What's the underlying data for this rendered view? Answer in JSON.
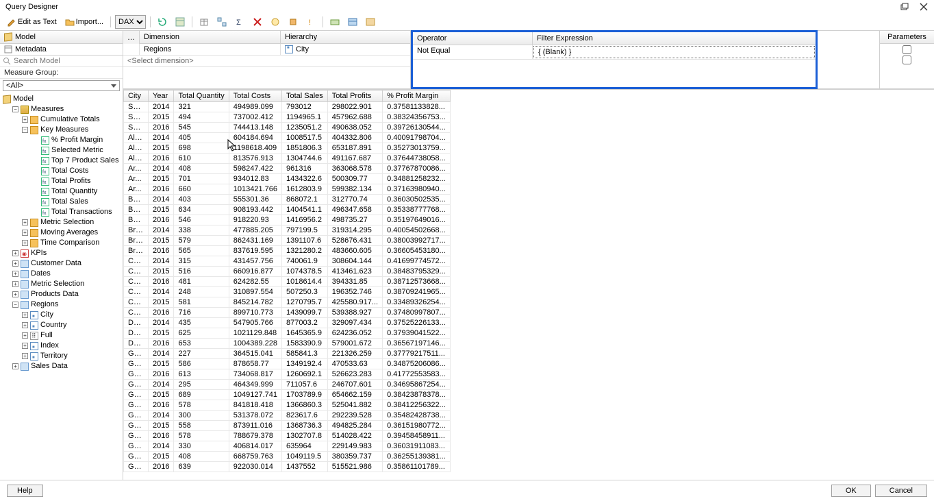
{
  "window": {
    "title": "Query Designer"
  },
  "toolbar": {
    "edit_as_text": "Edit as Text",
    "import": "Import...",
    "mode": "DAX"
  },
  "left": {
    "model_header": "Model",
    "metadata": "Metadata",
    "search_placeholder": "Search Model",
    "measure_group_label": "Measure Group:",
    "measure_group_value": "<All>",
    "tree": {
      "model": "Model",
      "measures": "Measures",
      "cumulative_totals": "Cumulative Totals",
      "key_measures": "Key Measures",
      "pct_profit_margin": "% Profit Margin",
      "selected_metric": "Selected Metric",
      "top7": "Top 7 Product Sales",
      "total_costs": "Total Costs",
      "total_profits": "Total Profits",
      "total_quantity": "Total Quantity",
      "total_sales": "Total Sales",
      "total_transactions": "Total Transactions",
      "metric_selection": "Metric Selection",
      "moving_averages": "Moving Averages",
      "time_comparison": "Time Comparison",
      "kpis": "KPIs",
      "customer_data": "Customer Data",
      "dates": "Dates",
      "metric_selection2": "Metric Selection",
      "products_data": "Products Data",
      "regions": "Regions",
      "city": "City",
      "country": "Country",
      "full": "Full",
      "index": "Index",
      "territory": "Territory",
      "sales_data": "Sales Data"
    }
  },
  "dim_area": {
    "dimension": "Dimension",
    "hierarchy": "Hierarchy",
    "row_dimension": "Regions",
    "row_hierarchy": "City",
    "select_dimension": "<Select dimension>"
  },
  "filter_area": {
    "operator": "Operator",
    "filter_expression": "Filter Expression",
    "row_operator": "Not Equal",
    "row_expression": "{ (Blank) }",
    "parameters": "Parameters"
  },
  "grid": {
    "headers": [
      "City",
      "Year",
      "Total Quantity",
      "Total Costs",
      "Total Sales",
      "Total Profits",
      "% Profit Margin"
    ],
    "rows": [
      [
        "Syd...",
        "2014",
        "321",
        "494989.099",
        "793012",
        "298022.901",
        "0.37581133828..."
      ],
      [
        "Syd...",
        "2015",
        "494",
        "737002.412",
        "1194965.1",
        "457962.688",
        "0.38324356753..."
      ],
      [
        "Syd...",
        "2016",
        "545",
        "744413.148",
        "1235051.2",
        "490638.052",
        "0.39726130544..."
      ],
      [
        "Alb...",
        "2014",
        "405",
        "604184.694",
        "1008517.5",
        "404332.806",
        "0.40091798704..."
      ],
      [
        "Alb...",
        "2015",
        "698",
        "1198618.409",
        "1851806.3",
        "653187.891",
        "0.35273013759..."
      ],
      [
        "Alb...",
        "2016",
        "610",
        "813576.913",
        "1304744.6",
        "491167.687",
        "0.37644738058..."
      ],
      [
        "Ar...",
        "2014",
        "408",
        "598247.422",
        "961316",
        "363068.578",
        "0.37767870086..."
      ],
      [
        "Ar...",
        "2015",
        "701",
        "934012.83",
        "1434322.6",
        "500309.77",
        "0.34881258232..."
      ],
      [
        "Ar...",
        "2016",
        "660",
        "1013421.766",
        "1612803.9",
        "599382.134",
        "0.37163980940..."
      ],
      [
        "Bat...",
        "2014",
        "403",
        "555301.36",
        "868072.1",
        "312770.74",
        "0.36030502535..."
      ],
      [
        "Bat...",
        "2015",
        "634",
        "908193.442",
        "1404541.1",
        "496347.658",
        "0.35338777768..."
      ],
      [
        "Bat...",
        "2016",
        "546",
        "918220.93",
        "1416956.2",
        "498735.27",
        "0.35197649016..."
      ],
      [
        "Bro...",
        "2014",
        "338",
        "477885.205",
        "797199.5",
        "319314.295",
        "0.40054502668..."
      ],
      [
        "Bro...",
        "2015",
        "579",
        "862431.169",
        "1391107.6",
        "528676.431",
        "0.38003992717..."
      ],
      [
        "Bro...",
        "2016",
        "565",
        "837619.595",
        "1321280.2",
        "483660.605",
        "0.36605453180..."
      ],
      [
        "Ces...",
        "2014",
        "315",
        "431457.756",
        "740061.9",
        "308604.144",
        "0.41699774572..."
      ],
      [
        "Ces...",
        "2015",
        "516",
        "660916.877",
        "1074378.5",
        "413461.623",
        "0.38483795329..."
      ],
      [
        "Ces...",
        "2016",
        "481",
        "624282.55",
        "1018614.4",
        "394331.85",
        "0.38712573668..."
      ],
      [
        "Cof...",
        "2014",
        "248",
        "310897.554",
        "507250.3",
        "196352.746",
        "0.38709241965..."
      ],
      [
        "Cof...",
        "2015",
        "581",
        "845214.782",
        "1270795.7",
        "425580.917...",
        "0.33489326254..."
      ],
      [
        "Cof...",
        "2016",
        "716",
        "899710.773",
        "1439099.7",
        "539388.927",
        "0.37480997807..."
      ],
      [
        "Du...",
        "2014",
        "435",
        "547905.766",
        "877003.2",
        "329097.434",
        "0.37525226133..."
      ],
      [
        "Du...",
        "2015",
        "625",
        "1021129.848",
        "1645365.9",
        "624236.052",
        "0.37939041522..."
      ],
      [
        "Du...",
        "2016",
        "653",
        "1004389.228",
        "1583390.9",
        "579001.672",
        "0.36567197146..."
      ],
      [
        "Go...",
        "2014",
        "227",
        "364515.041",
        "585841.3",
        "221326.259",
        "0.37779217511..."
      ],
      [
        "Go...",
        "2015",
        "586",
        "878658.77",
        "1349192.4",
        "470533.63",
        "0.34875206086..."
      ],
      [
        "Go...",
        "2016",
        "613",
        "734068.817",
        "1260692.1",
        "526623.283",
        "0.41772553583..."
      ],
      [
        "Go...",
        "2014",
        "295",
        "464349.999",
        "711057.6",
        "246707.601",
        "0.34695867254..."
      ],
      [
        "Go...",
        "2015",
        "689",
        "1049127.741",
        "1703789.9",
        "654662.159",
        "0.38423878378..."
      ],
      [
        "Go...",
        "2016",
        "578",
        "841818.418",
        "1366860.3",
        "525041.882",
        "0.38412256322..."
      ],
      [
        "Gra...",
        "2014",
        "300",
        "531378.072",
        "823617.6",
        "292239.528",
        "0.35482428738..."
      ],
      [
        "Gra...",
        "2015",
        "558",
        "873911.016",
        "1368736.3",
        "494825.284",
        "0.36151980772..."
      ],
      [
        "Gra...",
        "2016",
        "578",
        "788679.378",
        "1302707.8",
        "514028.422",
        "0.39458458911..."
      ],
      [
        "Grif...",
        "2014",
        "330",
        "406814.017",
        "635964",
        "229149.983",
        "0.36031911083..."
      ],
      [
        "Grif...",
        "2015",
        "408",
        "668759.763",
        "1049119.5",
        "380359.737",
        "0.36255139381..."
      ],
      [
        "Grif...",
        "2016",
        "639",
        "922030.014",
        "1437552",
        "515521.986",
        "0.35861101789..."
      ]
    ]
  },
  "footer": {
    "help": "Help",
    "ok": "OK",
    "cancel": "Cancel"
  }
}
